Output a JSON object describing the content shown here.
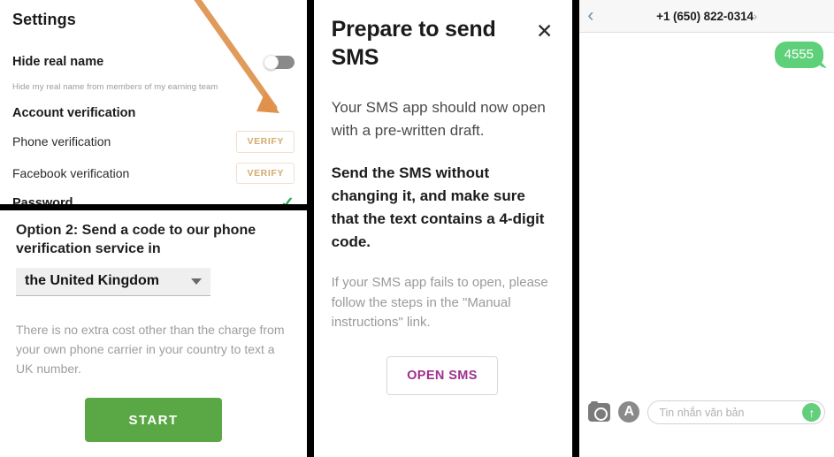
{
  "panel_settings": {
    "title": "Settings",
    "hide_real_name": {
      "label": "Hide real name",
      "note": "Hide my real name from members of my earning team",
      "toggle_state": "off"
    },
    "account_verification": {
      "heading": "Account verification",
      "rows": [
        {
          "label": "Phone verification",
          "action": "VERIFY"
        },
        {
          "label": "Facebook verification",
          "action": "VERIFY"
        }
      ]
    },
    "password": {
      "label": "Password",
      "status_icon": "check-icon",
      "status_glyph": "✓"
    },
    "arrow_annotation_color": "#e09a5a"
  },
  "panel_option2": {
    "title": "Option 2: Send a code to our phone verification service in",
    "country_select_value": "the United Kingdom",
    "note": "There is no extra cost other than the charge from your own phone carrier in your country to text a UK number.",
    "start_button": "START",
    "start_button_color": "#5aa746"
  },
  "panel_dialog": {
    "title": "Prepare to send SMS",
    "close_glyph": "✕",
    "paragraph_1": "Your SMS app should now open with a pre-written draft.",
    "paragraph_2_strong": "Send the SMS without changing it, and make sure that the text contains a 4-digit code.",
    "paragraph_3_muted": "If your SMS app fails to open, please follow the steps in the \"Manual instructions\" link.",
    "open_sms_button": "OPEN SMS",
    "open_sms_color": "#a02e8e"
  },
  "panel_sms": {
    "back_glyph": "‹",
    "contact": "+1 (650) 822-0314",
    "contact_chevron": "›",
    "messages": [
      {
        "text": "4555",
        "side": "outgoing",
        "bubble_color": "#5fd07a"
      }
    ],
    "composer": {
      "camera_icon": "camera-icon",
      "appstore_icon": "appstore-icon",
      "appstore_glyph": "A",
      "placeholder": "Tin nhắn văn bản",
      "send_glyph": "↑",
      "send_color": "#63cf7c"
    }
  }
}
